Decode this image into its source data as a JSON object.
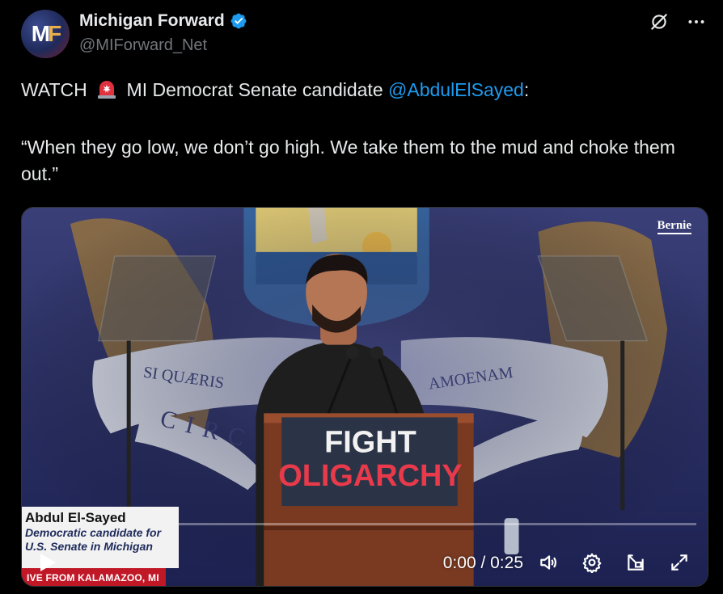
{
  "account": {
    "avatar_text": "MF",
    "display_name": "Michigan Forward",
    "handle": "@MIForward_Net",
    "verified": true
  },
  "top_actions": {
    "grok_icon": "grok-icon",
    "more_icon": "more-icon"
  },
  "tweet": {
    "line1_prefix": "WATCH",
    "line1_middle": "MI Democrat Senate candidate",
    "mention": "@AbdulElSayed",
    "line1_suffix": ":",
    "quote": "“When they go low, we don’t go high. We take them to the mud and choke them out.”"
  },
  "video": {
    "watermark": "Bernie",
    "lower_third_name": "Abdul El-Sayed",
    "lower_third_line1": "Democratic candidate for",
    "lower_third_line2": "U.S. Senate in Michigan",
    "live_banner": "IVE FROM KALAMAZOO, MI",
    "podium_line1": "FIGHT",
    "podium_line2": "OLIGARCHY",
    "banner_text_left": "SI QUÆRIS",
    "banner_text_right": "AMOENAM",
    "banner_text_bottom": "CIRC",
    "time_display": "0:00 / 0:25",
    "progress": 0
  },
  "colors": {
    "background": "#000000",
    "accent": "#1d9bf0",
    "text": "#e7e9ea",
    "muted": "#71767b"
  }
}
